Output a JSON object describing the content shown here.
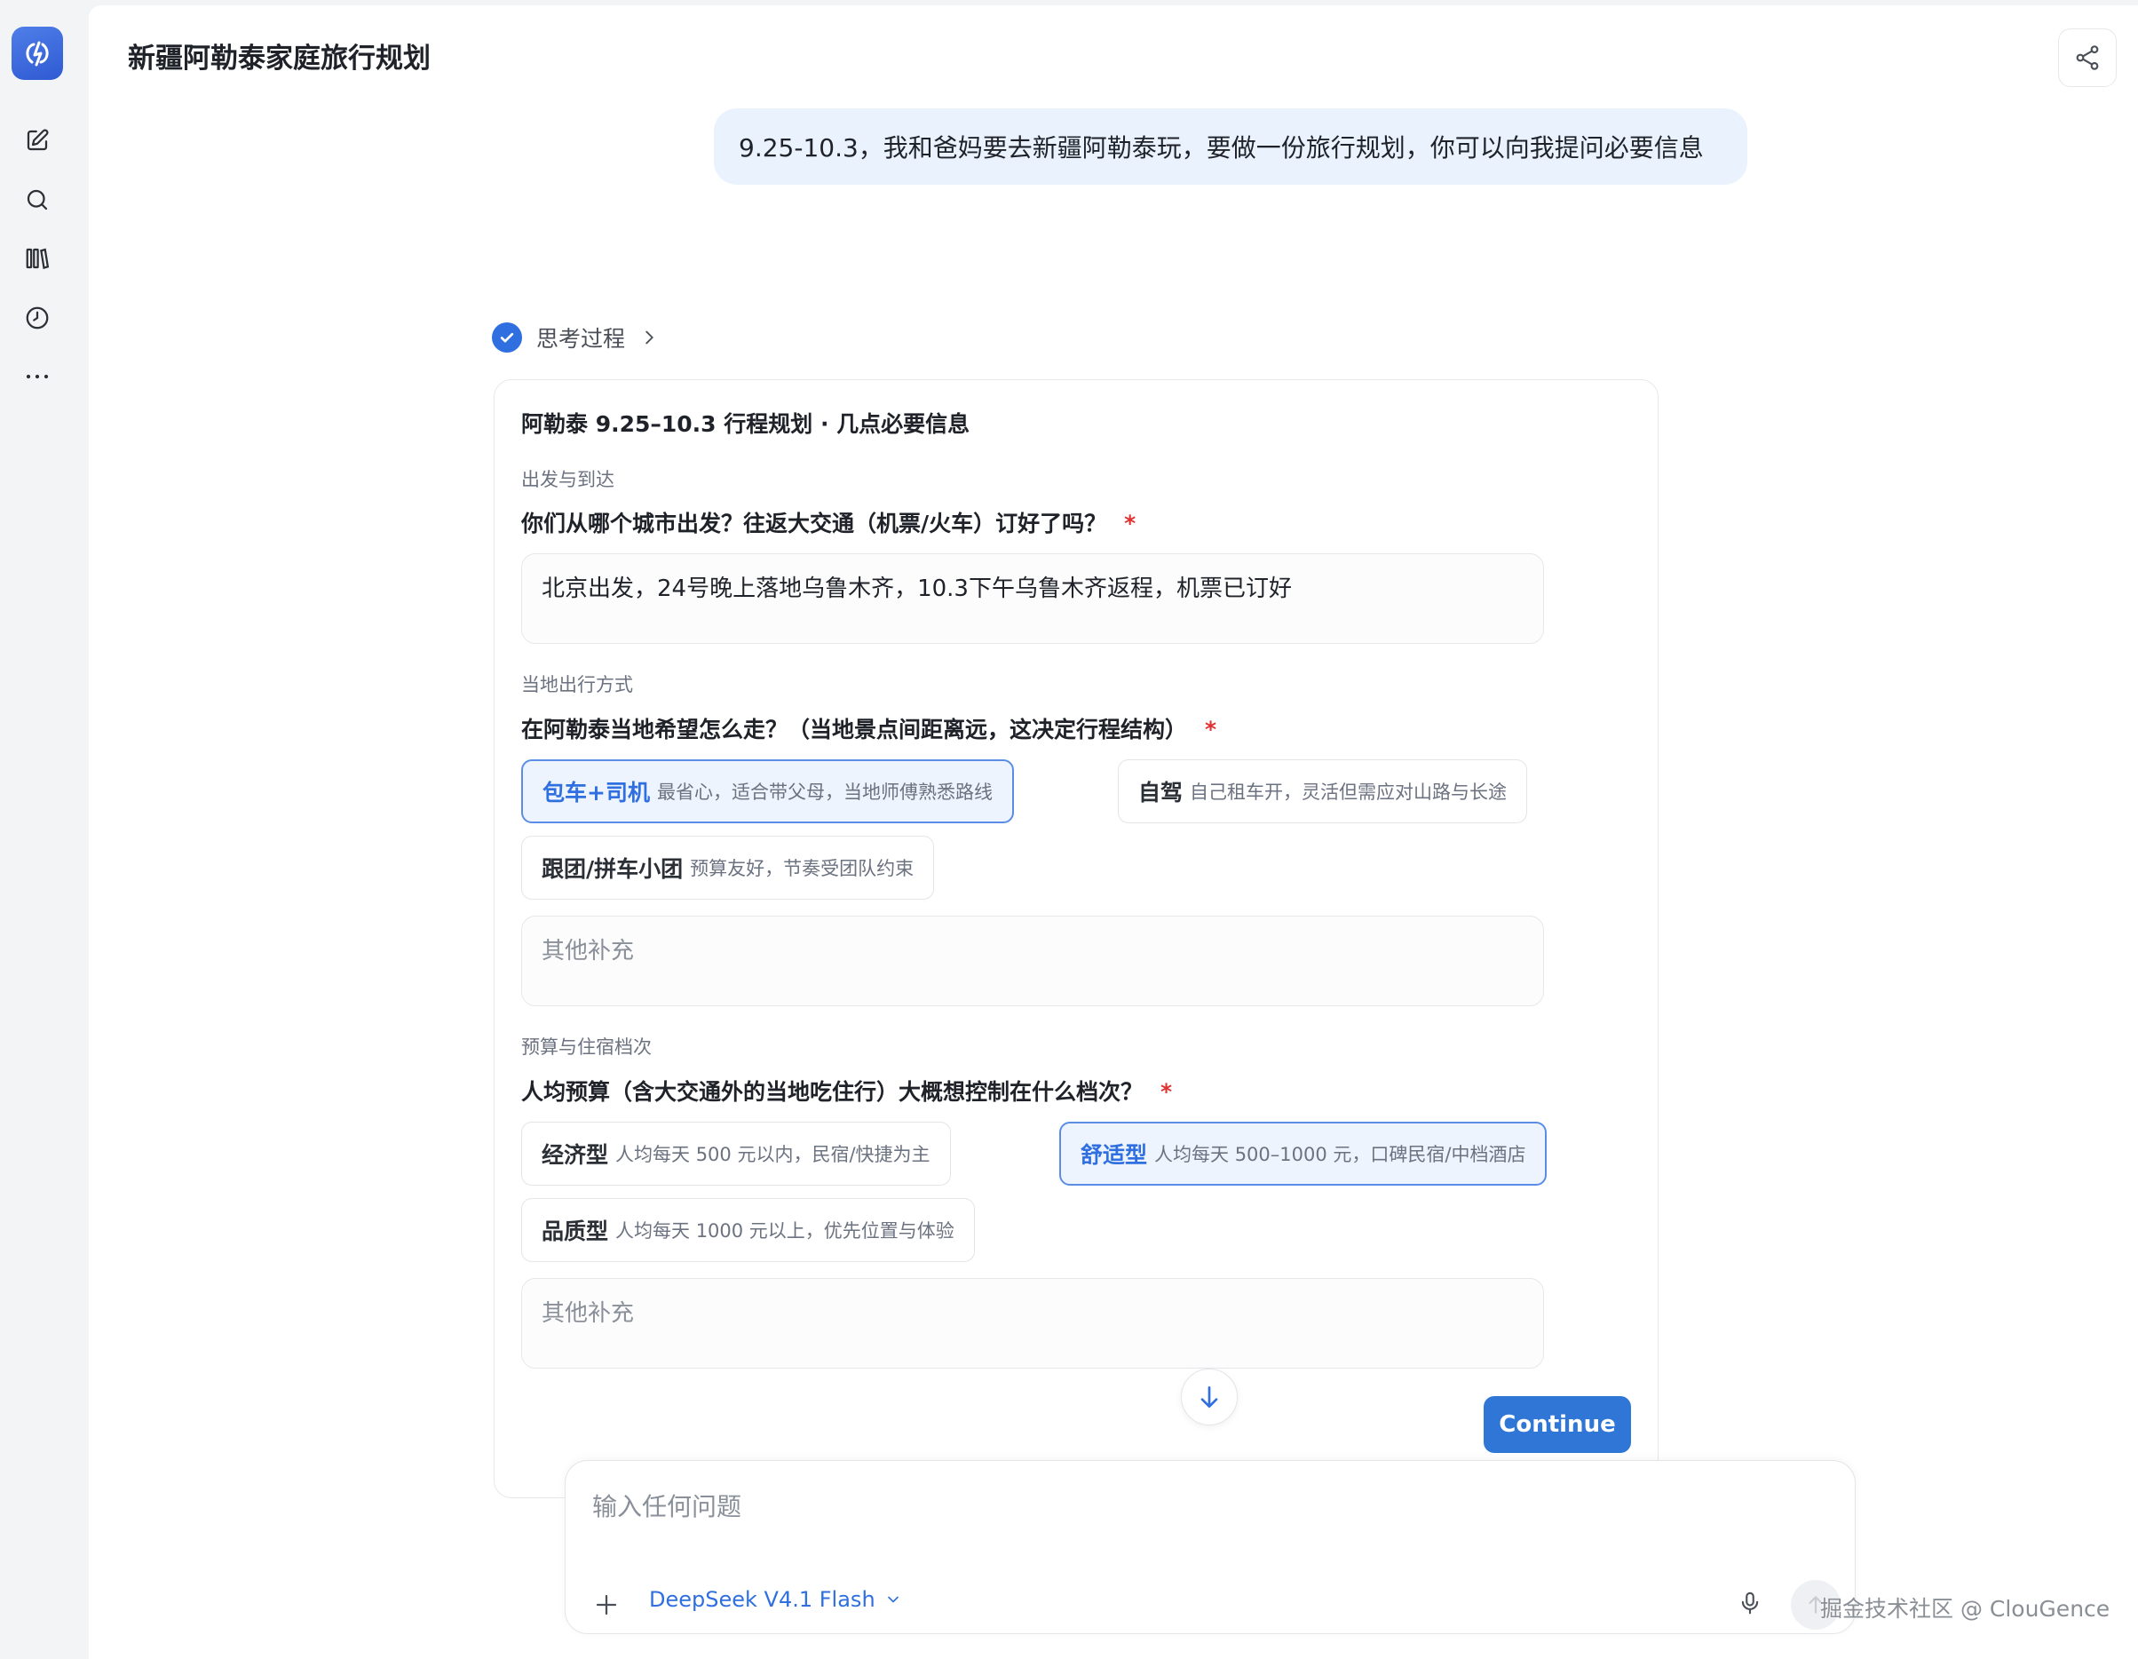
{
  "header": {
    "title": "新疆阿勒泰家庭旅行规划"
  },
  "sidebar": {
    "items": [
      {
        "name": "new-chat",
        "icon": "edit-icon"
      },
      {
        "name": "search",
        "icon": "search-icon"
      },
      {
        "name": "library",
        "icon": "library-icon"
      },
      {
        "name": "history",
        "icon": "history-icon"
      },
      {
        "name": "more",
        "icon": "more-icon"
      }
    ]
  },
  "user_message": "9.25-10.3，我和爸妈要去新疆阿勒泰玩，要做一份旅行规划，你可以向我提问必要信息",
  "thinking": {
    "label": "思考过程"
  },
  "form": {
    "title": "阿勒泰 9.25–10.3 行程规划 · 几点必要信息",
    "sections": [
      {
        "label": "出发与到达",
        "question": "你们从哪个城市出发？往返大交通（机票/火车）订好了吗？",
        "answer": "北京出发，24号晚上落地乌鲁木齐，10.3下午乌鲁木齐返程，机票已订好"
      },
      {
        "label": "当地出行方式",
        "question": "在阿勒泰当地希望怎么走？（当地景点间距离远，这决定行程结构）",
        "options": [
          {
            "title": "包车+司机",
            "desc": "最省心，适合带父母，当地师傅熟悉路线",
            "selected": true
          },
          {
            "title": "自驾",
            "desc": "自己租车开，灵活但需应对山路与长途",
            "selected": false
          },
          {
            "title": "跟团/拼车小团",
            "desc": "预算友好，节奏受团队约束",
            "selected": false
          }
        ],
        "other_placeholder": "其他补充"
      },
      {
        "label": "预算与住宿档次",
        "question": "人均预算（含大交通外的当地吃住行）大概想控制在什么档次？",
        "options": [
          {
            "title": "经济型",
            "desc": "人均每天 500 元以内，民宿/快捷为主",
            "selected": false
          },
          {
            "title": "舒适型",
            "desc": "人均每天 500–1000 元，口碑民宿/中档酒店",
            "selected": true
          },
          {
            "title": "品质型",
            "desc": "人均每天 1000 元以上，优先位置与体验",
            "selected": false
          }
        ],
        "other_placeholder": "其他补充"
      }
    ],
    "required_mark": "*",
    "continue_label": "Continue"
  },
  "composer": {
    "placeholder": "输入任何问题",
    "model": "DeepSeek V4.1 Flash"
  },
  "watermark": "掘金技术社区 @ ClouGence",
  "colors": {
    "accent": "#2f76d6",
    "selected_bg": "#eef4fe",
    "bubble_bg": "#eaf2fe",
    "required": "#e03131"
  }
}
